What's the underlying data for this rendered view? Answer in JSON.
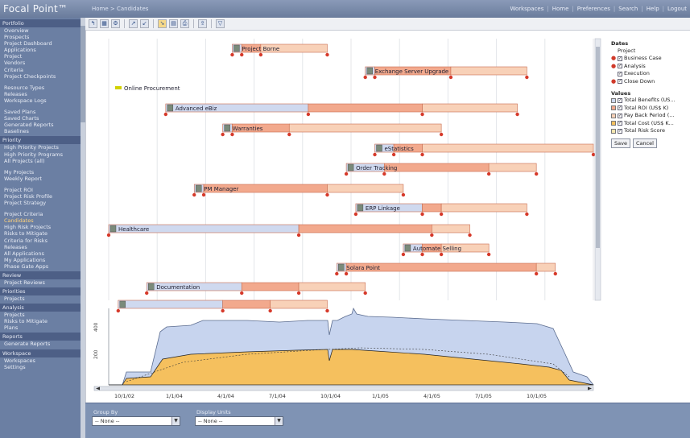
{
  "header": {
    "logo": "Focal Point™",
    "breadcrumb": "Home > Candidates",
    "nav": [
      "Workspaces",
      "Home",
      "Preferences",
      "Search",
      "Help",
      "Logout"
    ]
  },
  "sidebar": {
    "groups": [
      {
        "title": "Portfolio",
        "items": [
          "Overview",
          "Prospects",
          "Project Dashboard",
          "Applications",
          "Project",
          "Vendors",
          "Criteria",
          "Project Checkpoints"
        ]
      },
      {
        "title": "",
        "items": [
          "Resource Types",
          "Releases",
          "Workspace Logs"
        ]
      },
      {
        "title": "",
        "items": [
          "Saved Plans",
          "Saved Charts",
          "Generated Reports",
          "Baselines"
        ]
      },
      {
        "title": "Priority",
        "items": [
          "High Priority Projects",
          "High Priority Programs",
          "All Projects (all)"
        ]
      },
      {
        "title": "",
        "items": [
          "My Projects",
          "Weekly Report"
        ]
      },
      {
        "title": "",
        "items": [
          "Project ROI",
          "Project Risk Profile",
          "Project Strategy"
        ]
      },
      {
        "title": "",
        "items": [
          "Project Criteria",
          "Candidates",
          "High Risk Projects",
          "Risks to Mitigate",
          "Criteria for Risks",
          "Releases",
          "All Applications",
          "My Applications",
          "Phase Gate Apps"
        ]
      },
      {
        "title": "Review",
        "items": [
          "Project Reviews"
        ]
      },
      {
        "title": "Priorities",
        "items": [
          "Projects"
        ]
      },
      {
        "title": "Analysis",
        "items": [
          "Projects",
          "Risks to Mitigate",
          "Plans"
        ]
      },
      {
        "title": "Reports",
        "items": [
          "Generate Reports"
        ]
      },
      {
        "title": "Workspace",
        "items": [
          "Workspaces",
          "Settings"
        ]
      }
    ],
    "active_item": "Candidates"
  },
  "toolbar": {
    "buttons": [
      "back-icon",
      "grid-icon",
      "settings-icon",
      "zoom-in-icon",
      "zoom-out-icon",
      "pointer-icon",
      "table-icon",
      "print-icon",
      "export-icon",
      "filter-icon"
    ]
  },
  "chart_data": {
    "type": "gantt",
    "phases": [
      "Business Case",
      "Analysis",
      "Execution",
      "Close Down"
    ],
    "phase_colors": {
      "Business Case": "#cfd9ef",
      "Analysis": "#f2a98d",
      "Execution": "#f8d1b8"
    },
    "timeline": {
      "start": "2001-10",
      "end": "2006-01"
    },
    "bars": [
      {
        "label": "Project Borne",
        "start": "2002-11",
        "phase_ends": [
          "2002-12",
          "2003-02",
          "2003-09"
        ]
      },
      {
        "label": "Exchange Server Upgrade",
        "start": "2004-01",
        "phase_ends": [
          "2004-02",
          "2004-10",
          "2005-06"
        ]
      },
      {
        "label": "Online Procurement",
        "start": null,
        "phase_ends": []
      },
      {
        "label": "Advanced eBiz",
        "start": "2002-04",
        "phase_ends": [
          "2003-07",
          "2004-07",
          "2005-05"
        ]
      },
      {
        "label": "Warranties",
        "start": "2002-10",
        "phase_ends": [
          "2002-11",
          "2003-05",
          "2004-09"
        ]
      },
      {
        "label": "eStatistics",
        "start": "2004-02",
        "phase_ends": [
          "2004-04",
          "2004-07",
          "2006-01"
        ]
      },
      {
        "label": "Order Tracking",
        "start": "2003-11",
        "phase_ends": [
          "2004-03",
          "2005-02",
          "2005-07"
        ]
      },
      {
        "label": "PM Manager",
        "start": "2002-07",
        "phase_ends": [
          "2002-08",
          "2003-09",
          "2004-05"
        ]
      },
      {
        "label": "ERP Linkage",
        "start": "2003-12",
        "phase_ends": [
          "2004-07",
          "2004-09",
          "2005-06"
        ]
      },
      {
        "label": "Healthcare",
        "start": "2001-10",
        "phase_ends": [
          "2003-06",
          "2004-08",
          "2004-12"
        ]
      },
      {
        "label": "Automate Selling",
        "start": "2004-05",
        "phase_ends": [
          "2004-07",
          "2004-09",
          "2005-02"
        ]
      },
      {
        "label": "Solara Point",
        "start": "2003-10",
        "phase_ends": [
          "2003-11",
          "2005-07",
          "2005-09"
        ]
      },
      {
        "label": "Documentation",
        "start": "2002-02",
        "phase_ends": [
          "2002-12",
          "2003-06",
          "2004-01"
        ]
      },
      {
        "label": "",
        "start": "2001-11",
        "phase_ends": [
          "2002-10",
          "2003-03",
          "2003-09"
        ]
      }
    ],
    "area_series": [
      {
        "name": "Business Case",
        "color": "#c7d4ee"
      },
      {
        "name": "Analysis",
        "color": "#f5c05e"
      }
    ],
    "area_y_labels": [
      "400",
      "200"
    ],
    "x_tick_labels": [
      "10/1/02",
      "1/1/04",
      "4/1/04",
      "7/1/04",
      "10/1/04",
      "1/1/05",
      "4/1/05",
      "7/1/05",
      "10/1/05"
    ]
  },
  "right_panel": {
    "dates_title": "Dates",
    "dates_sub": "Project",
    "phases": [
      {
        "label": "Business Case",
        "pin": true
      },
      {
        "label": "Analysis",
        "pin": true
      },
      {
        "label": "Execution",
        "pin": false
      },
      {
        "label": "Close Down",
        "pin": true
      }
    ],
    "values_title": "Values",
    "values": [
      {
        "label": "Total Benefits (US...",
        "color": "#cfd9ef"
      },
      {
        "label": "Total ROI (US$ K)",
        "color": "#f2a98d"
      },
      {
        "label": "Pay Back Period (...",
        "color": "#f8d1b8"
      },
      {
        "label": "Total Cost (US$ K...",
        "color": "#f5c05e"
      },
      {
        "label": "Total Risk Score",
        "color": "#f4e6b0"
      }
    ],
    "save_label": "Save",
    "cancel_label": "Cancel"
  },
  "bottom": {
    "group_by_label": "Group By",
    "group_by_value": "-- None --",
    "display_label": "Display Units",
    "display_value": "-- None --"
  }
}
